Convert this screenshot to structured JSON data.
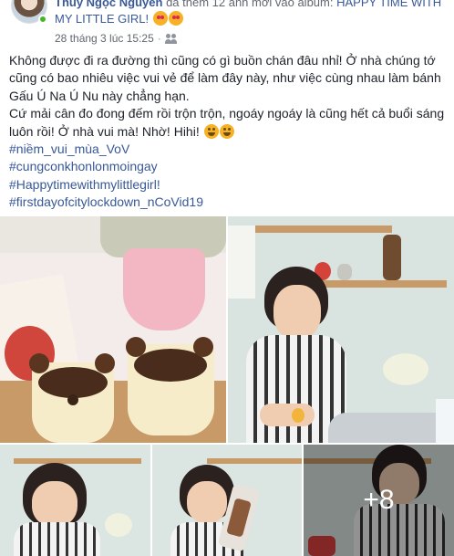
{
  "post": {
    "author": "Thủy Ngọc Nguyễn",
    "action": " đã thêm 12 ảnh mới vào album: ",
    "album": "HAPPY TIME WITH MY LITTLE GIRL!",
    "timestamp": "28 tháng 3 lúc 15:25",
    "separator": "·",
    "audience_icon": "friends-icon",
    "header_emoji": [
      "smiling-face-with-hearts-emoji",
      "smiling-face-with-hearts-emoji"
    ],
    "text_lines": [
      "Không được đi ra đường thì cũng có gì buồn chán đâu nhỉ! Ở nhà chúng tớ cũng có bao nhiêu việc vui vẻ để làm đây này, như việc cùng nhau làm bánh Gấu Ú Na Ú Nu này chẳng hạn.",
      "Cứ mải cân đo đong đếm rồi trộn trộn, ngoáy ngoáy là cũng hết cả buổi sáng luôn rồi! Ở nhà vui mà! Nhờ! Hihi!"
    ],
    "text_emoji": [
      "grinning-face-emoji",
      "grinning-face-emoji"
    ],
    "hashtags": [
      "#niềm_vui_mùa_VoV",
      "#cungconkhonlonmoingay",
      "#Happytimewithmylittlegirl!",
      "#firstdayofcitylockdown_nCoVid19"
    ]
  },
  "photos": {
    "items": [
      {
        "description": "bear-tiramisu-cups"
      },
      {
        "description": "girl-cracking-egg"
      },
      {
        "description": "girl-at-counter"
      },
      {
        "description": "girl-holding-bag"
      },
      {
        "description": "girl-mixing"
      }
    ],
    "more_count": "+8"
  },
  "colors": {
    "link": "#385898",
    "text": "#1d2129",
    "meta": "#616770",
    "online": "#42b72a"
  }
}
